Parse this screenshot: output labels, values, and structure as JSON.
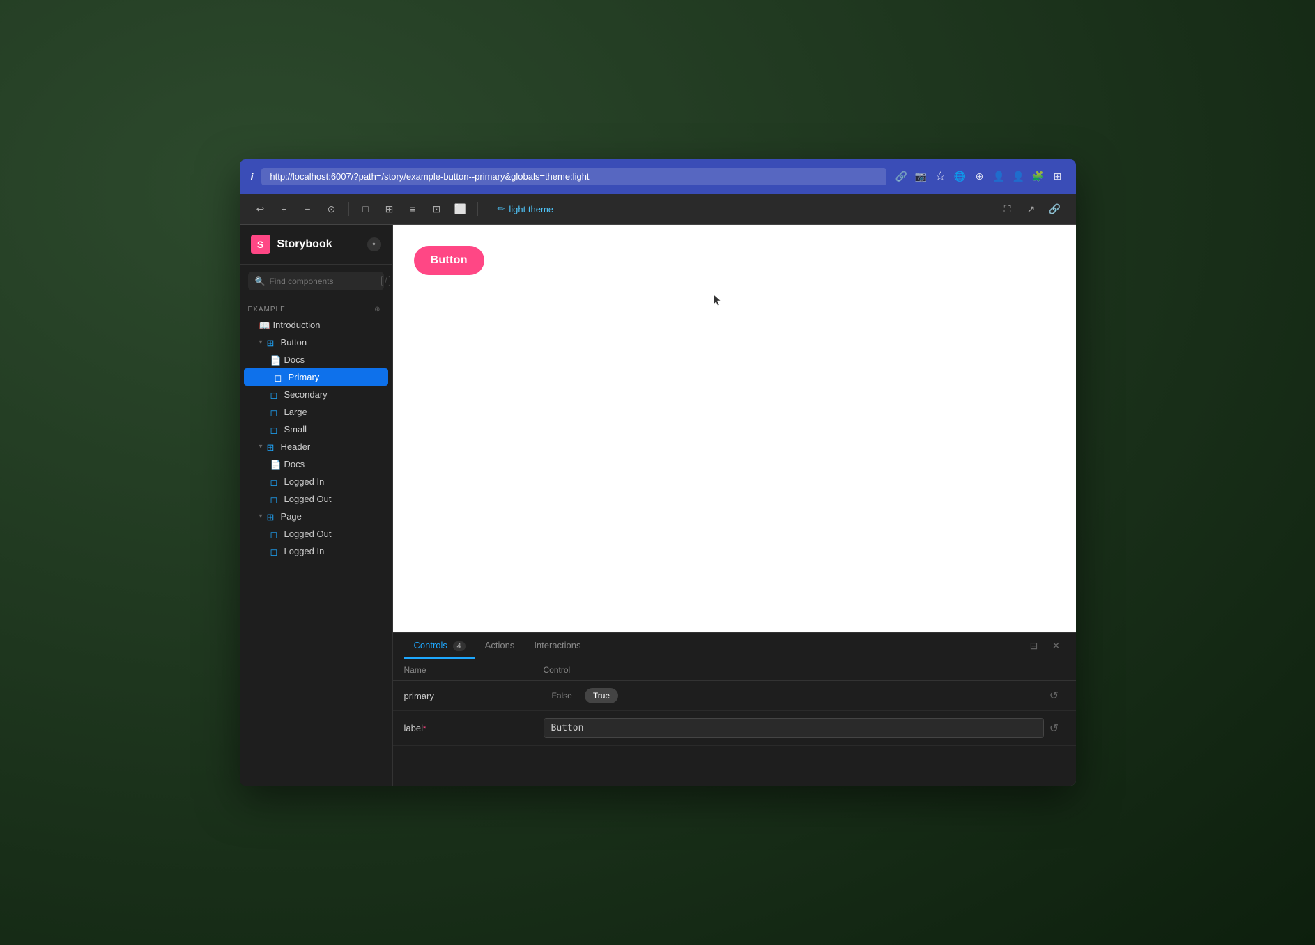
{
  "browser": {
    "url": "http://localhost:6007/?path=/story/example-button--primary&globals=theme:light",
    "info_icon": "i"
  },
  "toolbar": {
    "theme_label": "light theme",
    "pencil_unicode": "✏"
  },
  "sidebar": {
    "logo_text": "Storybook",
    "logo_letter": "S",
    "search_placeholder": "Find components",
    "search_shortcut": "/",
    "section_label": "EXAMPLE",
    "items": [
      {
        "label": "Introduction",
        "type": "docs",
        "indent": 1
      },
      {
        "label": "Button",
        "type": "component",
        "indent": 1,
        "collapsed": false
      },
      {
        "label": "Docs",
        "type": "docs",
        "indent": 2
      },
      {
        "label": "Primary",
        "type": "story",
        "indent": 2,
        "active": true
      },
      {
        "label": "Secondary",
        "type": "story",
        "indent": 2
      },
      {
        "label": "Large",
        "type": "story",
        "indent": 2
      },
      {
        "label": "Small",
        "type": "story",
        "indent": 2
      },
      {
        "label": "Header",
        "type": "component",
        "indent": 1,
        "collapsed": false
      },
      {
        "label": "Docs",
        "type": "docs",
        "indent": 2
      },
      {
        "label": "Logged In",
        "type": "story",
        "indent": 2
      },
      {
        "label": "Logged Out",
        "type": "story",
        "indent": 2
      },
      {
        "label": "Page",
        "type": "component",
        "indent": 1,
        "collapsed": false
      },
      {
        "label": "Logged Out",
        "type": "story",
        "indent": 2
      },
      {
        "label": "Logged In",
        "type": "story",
        "indent": 2
      }
    ]
  },
  "preview": {
    "button_label": "Button"
  },
  "bottom_panel": {
    "tabs": [
      {
        "label": "Controls",
        "badge": "4",
        "active": true
      },
      {
        "label": "Actions",
        "badge": "",
        "active": false
      },
      {
        "label": "Interactions",
        "badge": "",
        "active": false
      }
    ],
    "table_header": {
      "name_col": "Name",
      "control_col": "Control"
    },
    "rows": [
      {
        "name": "primary",
        "required": false,
        "control_type": "boolean",
        "false_label": "False",
        "true_label": "True",
        "active_value": "True"
      },
      {
        "name": "label",
        "required": true,
        "control_type": "text",
        "value": "Button"
      }
    ]
  }
}
